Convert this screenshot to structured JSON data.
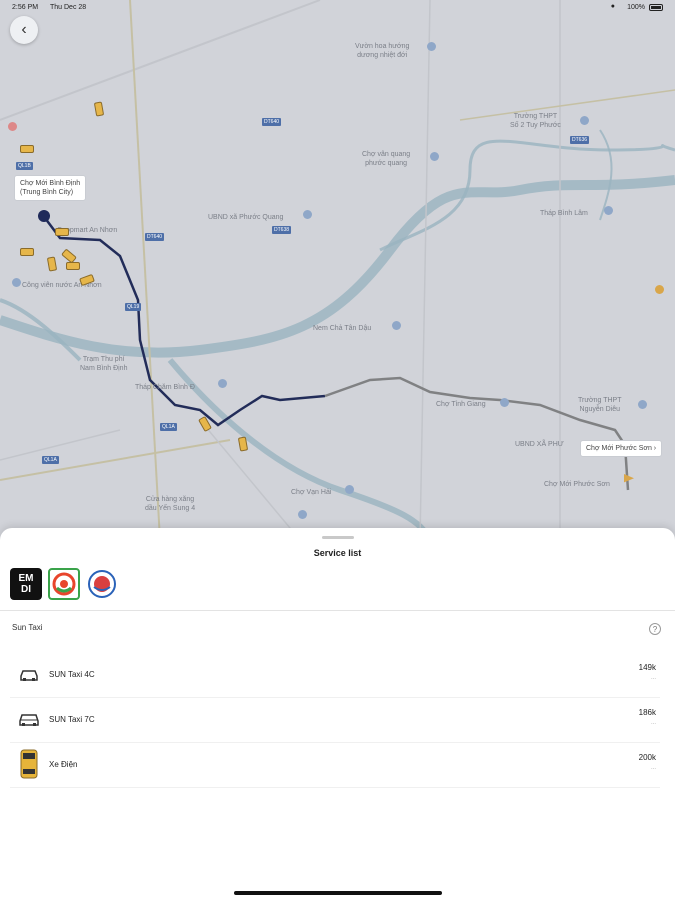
{
  "status_bar": {
    "time": "2:56 PM",
    "date": "Thu Dec 28",
    "battery": "100%"
  },
  "map": {
    "labels": {
      "vuon_hoa": "Vườn hoa hướng\ndương nhiệt đới",
      "truong_thpt_so2": "Trường THPT\nSố 2 Tuy Phước",
      "cho_van_quang": "Chợ vân quang\nphước quang",
      "cho_moi_binh_dinh": "Chợ Mới Bình Định\n(Trung Bình City)",
      "ubnd_phuoc_quang": "UBND xã Phước Quang",
      "thap_binh_lam": "Tháp Bình Lâm",
      "co_ngan_nhan": "Coopmart An Nhơn",
      "cong_vien": "Công viên nước An Nhơn",
      "nem_cha": "Nem Chả Tân Dậu",
      "tram_thu_phi": "Trạm Thu phí\nNam Bình Định",
      "thap_cham": "Tháp Chăm Bình Đ",
      "cho_tinh_giang": "Chợ Tỉnh Giang",
      "truong_thpt_ng": "Trường THPT\nNguyễn Diêu",
      "ubnd_xa_phuoc": "UBND XÃ PHƯ",
      "cho_moi_phuoc_son": "Chợ Mới Phước Sơn",
      "cho_ven_hai": "Chợ Vạn Hải",
      "cua_hang_xang": "Cửa hàng xăng\ndầu Yến Sung 4"
    },
    "road_tags": [
      "DT640",
      "DT638",
      "QL19",
      "DT636",
      "QL1A",
      "QL1A",
      "QL1B",
      "DT640"
    ],
    "callouts": {
      "start": "Chợ Mới Bình Định\n(Trung Bình City)",
      "end": "Chợ Mới Phước Sơn"
    }
  },
  "sheet": {
    "title": "Service list",
    "providers": [
      {
        "name": "emdi-logo",
        "text": "EM\nDI"
      },
      {
        "name": "sun-taxi-logo",
        "text": ""
      },
      {
        "name": "blue-taxi-logo",
        "text": ""
      }
    ],
    "group_label": "Sun Taxi",
    "services": [
      {
        "name": "SUN Taxi 4C",
        "price": "149k",
        "sub": "...",
        "icon": "sedan-icon"
      },
      {
        "name": "SUN Taxi 7C",
        "price": "186k",
        "sub": "...",
        "icon": "suv-icon"
      },
      {
        "name": "Xe Điện",
        "price": "200k",
        "sub": "...",
        "icon": "electric-car-icon"
      }
    ]
  },
  "colors": {
    "route_active": "#1f2a5a",
    "route_pending": "#8a8a8a",
    "water": "#a7c3cf",
    "accent_green": "#3aa34a"
  }
}
